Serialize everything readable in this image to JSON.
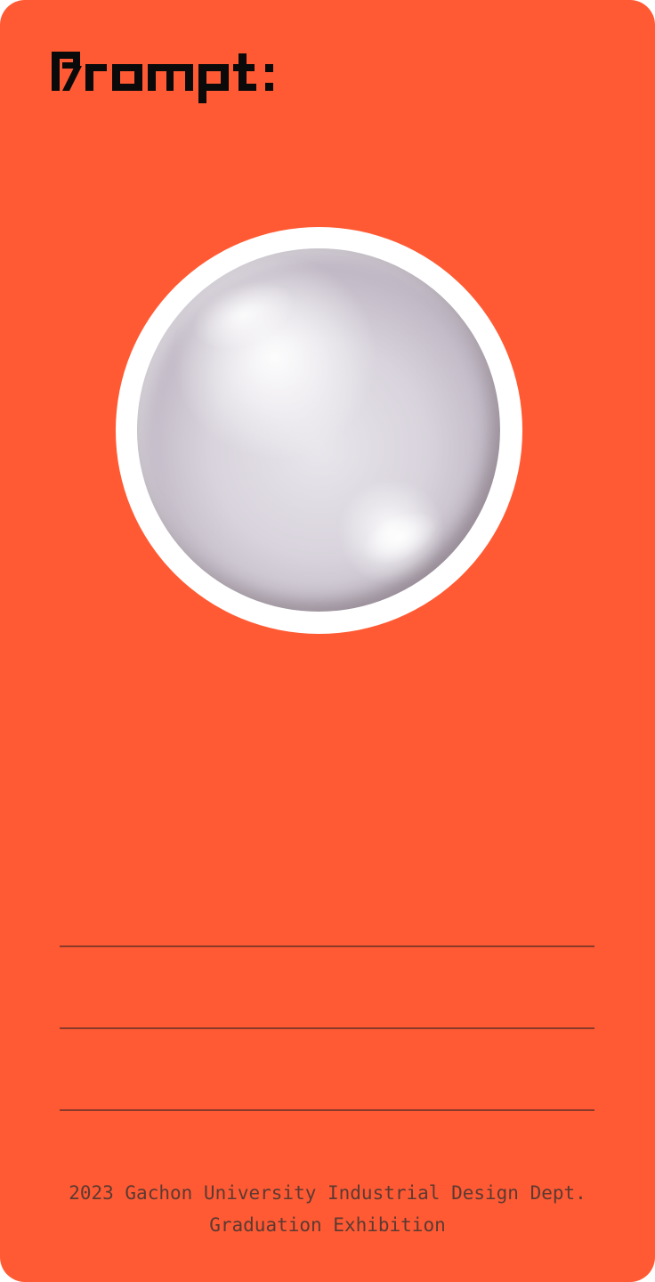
{
  "card": {
    "background_color": "#ff5a33"
  },
  "logo": {
    "text": "Prompt:",
    "color": "#0a0a0a"
  },
  "hero": {
    "image_description": "glass-sphere"
  },
  "footer": {
    "line1": "2023 Gachon University Industrial Design Dept.",
    "line2": "Graduation Exhibition"
  }
}
